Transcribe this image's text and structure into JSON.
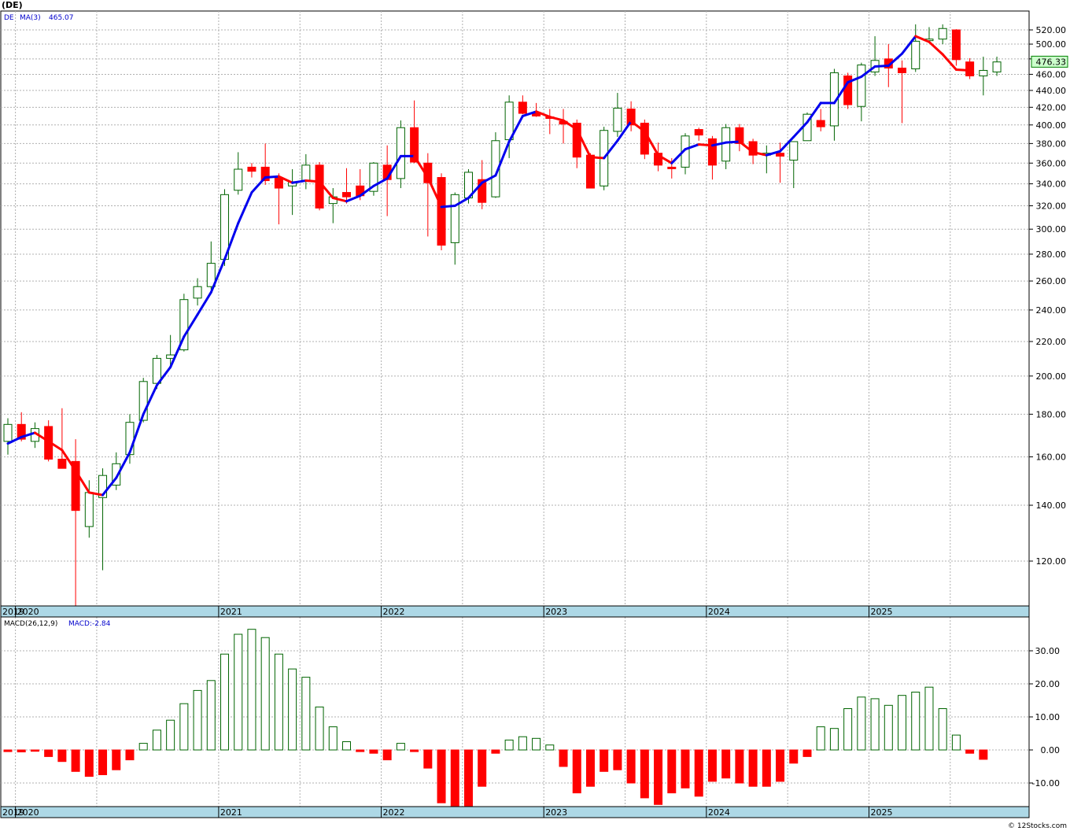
{
  "page": {
    "title": "(DE)",
    "credit": "© 12Stocks.com"
  },
  "colors": {
    "up_candle": "#006400",
    "down_candle": "#ff0000",
    "ma_up": "#0000ee",
    "ma_down": "#ff0000",
    "axis_band": "#add8e6",
    "grid": "#b0b0b0",
    "last_price_box": "#ccffcc"
  },
  "chart_data": [
    {
      "type": "candlestick",
      "ticker": "DE",
      "legend_ticker": "DE",
      "ma_label": "MA(3)",
      "ma_value": "465.07",
      "last_price": "476.33",
      "y_scale": "log",
      "ylim": [
        100,
        540
      ],
      "grid": true,
      "y_ticks": [
        "120.00",
        "140.00",
        "160.00",
        "180.00",
        "200.00",
        "220.00",
        "240.00",
        "260.00",
        "280.00",
        "300.00",
        "320.00",
        "340.00",
        "360.00",
        "380.00",
        "400.00",
        "420.00",
        "440.00",
        "460.00",
        "480.00",
        "500.00",
        "520.00"
      ],
      "x_year_labels": [
        "2019",
        "2020",
        "2021",
        "2022",
        "2023",
        "2024",
        "2025"
      ],
      "x_year_starts": [
        "2019-12",
        "2020-01",
        "2021-01",
        "2022-01",
        "2023-01",
        "2024-01",
        "2025-01"
      ],
      "candles": [
        {
          "d": "2019-12",
          "o": 167,
          "h": 178,
          "l": 161,
          "c": 175
        },
        {
          "d": "2020-01",
          "o": 175,
          "h": 181,
          "l": 167,
          "c": 168
        },
        {
          "d": "2020-01b",
          "o": 167,
          "h": 176,
          "l": 164,
          "c": 173
        },
        {
          "d": "2020-02",
          "o": 174,
          "h": 177,
          "l": 158,
          "c": 159
        },
        {
          "d": "2020-02b",
          "o": 159,
          "h": 183,
          "l": 157,
          "c": 155
        },
        {
          "d": "2020-03",
          "o": 158,
          "h": 168,
          "l": 106,
          "c": 138
        },
        {
          "d": "2020-03b",
          "o": 132,
          "h": 150,
          "l": 128,
          "c": 145
        },
        {
          "d": "2020-04",
          "o": 143,
          "h": 155,
          "l": 117,
          "c": 152
        },
        {
          "d": "2020-05",
          "o": 148,
          "h": 162,
          "l": 146,
          "c": 157
        },
        {
          "d": "2020-06",
          "o": 161,
          "h": 180,
          "l": 157,
          "c": 176
        },
        {
          "d": "2020-07",
          "o": 177,
          "h": 199,
          "l": 176,
          "c": 197
        },
        {
          "d": "2020-08",
          "o": 196,
          "h": 212,
          "l": 193,
          "c": 210
        },
        {
          "d": "2020-09",
          "o": 210,
          "h": 224,
          "l": 204,
          "c": 212
        },
        {
          "d": "2020-10",
          "o": 215,
          "h": 251,
          "l": 214,
          "c": 247
        },
        {
          "d": "2020-11",
          "o": 248,
          "h": 262,
          "l": 243,
          "c": 256
        },
        {
          "d": "2020-12",
          "o": 256,
          "h": 290,
          "l": 254,
          "c": 273
        },
        {
          "d": "2021-01",
          "o": 276,
          "h": 335,
          "l": 271,
          "c": 330
        },
        {
          "d": "2021-02",
          "o": 334,
          "h": 371,
          "l": 330,
          "c": 354
        },
        {
          "d": "2021-03",
          "o": 356,
          "h": 360,
          "l": 346,
          "c": 352
        },
        {
          "d": "2021-04",
          "o": 356,
          "h": 380,
          "l": 339,
          "c": 343
        },
        {
          "d": "2021-05",
          "o": 346,
          "h": 350,
          "l": 304,
          "c": 336
        },
        {
          "d": "2021-06",
          "o": 338,
          "h": 354,
          "l": 312,
          "c": 342
        },
        {
          "d": "2021-07",
          "o": 343,
          "h": 369,
          "l": 335,
          "c": 358
        },
        {
          "d": "2021-08",
          "o": 358,
          "h": 361,
          "l": 316,
          "c": 318
        },
        {
          "d": "2021-09",
          "o": 322,
          "h": 336,
          "l": 305,
          "c": 328
        },
        {
          "d": "2021-10",
          "o": 332,
          "h": 355,
          "l": 322,
          "c": 328
        },
        {
          "d": "2021-11",
          "o": 338,
          "h": 354,
          "l": 325,
          "c": 329
        },
        {
          "d": "2021-12",
          "o": 333,
          "h": 361,
          "l": 329,
          "c": 360
        },
        {
          "d": "2022-01",
          "o": 358,
          "h": 378,
          "l": 311,
          "c": 344
        },
        {
          "d": "2022-02",
          "o": 345,
          "h": 405,
          "l": 336,
          "c": 397
        },
        {
          "d": "2022-03",
          "o": 397,
          "h": 428,
          "l": 360,
          "c": 361
        },
        {
          "d": "2022-04",
          "o": 360,
          "h": 370,
          "l": 294,
          "c": 341
        },
        {
          "d": "2022-05",
          "o": 346,
          "h": 350,
          "l": 283,
          "c": 287
        },
        {
          "d": "2022-06",
          "o": 289,
          "h": 332,
          "l": 272,
          "c": 330
        },
        {
          "d": "2022-07",
          "o": 327,
          "h": 354,
          "l": 322,
          "c": 351
        },
        {
          "d": "2022-08",
          "o": 344,
          "h": 363,
          "l": 317,
          "c": 323
        },
        {
          "d": "2022-09",
          "o": 328,
          "h": 392,
          "l": 327,
          "c": 383
        },
        {
          "d": "2022-10",
          "o": 384,
          "h": 434,
          "l": 365,
          "c": 426
        },
        {
          "d": "2022-11",
          "o": 426,
          "h": 434,
          "l": 412,
          "c": 413
        },
        {
          "d": "2022-12",
          "o": 413,
          "h": 425,
          "l": 409,
          "c": 410
        },
        {
          "d": "2023-01",
          "o": 409,
          "h": 418,
          "l": 390,
          "c": 408
        },
        {
          "d": "2023-02",
          "o": 404,
          "h": 418,
          "l": 380,
          "c": 401
        },
        {
          "d": "2023-03",
          "o": 402,
          "h": 406,
          "l": 355,
          "c": 366
        },
        {
          "d": "2023-04",
          "o": 368,
          "h": 370,
          "l": 336,
          "c": 336
        },
        {
          "d": "2023-05",
          "o": 338,
          "h": 398,
          "l": 334,
          "c": 394
        },
        {
          "d": "2023-06",
          "o": 393,
          "h": 437,
          "l": 387,
          "c": 419
        },
        {
          "d": "2023-07",
          "o": 418,
          "h": 427,
          "l": 393,
          "c": 400
        },
        {
          "d": "2023-08",
          "o": 402,
          "h": 406,
          "l": 364,
          "c": 369
        },
        {
          "d": "2023-09",
          "o": 370,
          "h": 381,
          "l": 352,
          "c": 358
        },
        {
          "d": "2023-10",
          "o": 356,
          "h": 365,
          "l": 345,
          "c": 355
        },
        {
          "d": "2023-11",
          "o": 356,
          "h": 391,
          "l": 349,
          "c": 388
        },
        {
          "d": "2023-12",
          "o": 395,
          "h": 397,
          "l": 383,
          "c": 389
        },
        {
          "d": "2024-01",
          "o": 385,
          "h": 388,
          "l": 344,
          "c": 358
        },
        {
          "d": "2024-02",
          "o": 362,
          "h": 401,
          "l": 354,
          "c": 397
        },
        {
          "d": "2024-03",
          "o": 397,
          "h": 401,
          "l": 372,
          "c": 380
        },
        {
          "d": "2024-04",
          "o": 382,
          "h": 385,
          "l": 359,
          "c": 368
        },
        {
          "d": "2024-05",
          "o": 368,
          "h": 378,
          "l": 350,
          "c": 370
        },
        {
          "d": "2024-06",
          "o": 370,
          "h": 381,
          "l": 341,
          "c": 367
        },
        {
          "d": "2024-07",
          "o": 363,
          "h": 382,
          "l": 336,
          "c": 382
        },
        {
          "d": "2024-08",
          "o": 383,
          "h": 414,
          "l": 383,
          "c": 412
        },
        {
          "d": "2024-09",
          "o": 405,
          "h": 418,
          "l": 393,
          "c": 398
        },
        {
          "d": "2024-10",
          "o": 399,
          "h": 467,
          "l": 383,
          "c": 462
        },
        {
          "d": "2024-11",
          "o": 458,
          "h": 462,
          "l": 418,
          "c": 423
        },
        {
          "d": "2024-12",
          "o": 421,
          "h": 475,
          "l": 404,
          "c": 472
        },
        {
          "d": "2025-01",
          "o": 463,
          "h": 511,
          "l": 458,
          "c": 478
        },
        {
          "d": "2025-02",
          "o": 480,
          "h": 500,
          "l": 444,
          "c": 468
        },
        {
          "d": "2025-03",
          "o": 468,
          "h": 478,
          "l": 402,
          "c": 462
        },
        {
          "d": "2025-04",
          "o": 467,
          "h": 528,
          "l": 463,
          "c": 504
        },
        {
          "d": "2025-05",
          "o": 505,
          "h": 524,
          "l": 504,
          "c": 507
        },
        {
          "d": "2025-06",
          "o": 507,
          "h": 528,
          "l": 500,
          "c": 522
        },
        {
          "d": "2025-07",
          "o": 520,
          "h": 521,
          "l": 471,
          "c": 479
        },
        {
          "d": "2025-08",
          "o": 476,
          "h": 481,
          "l": 454,
          "c": 458
        },
        {
          "d": "2025-09",
          "o": 458,
          "h": 483,
          "l": 434,
          "c": 465
        },
        {
          "d": "2025-10",
          "o": 463,
          "h": 483,
          "l": 458,
          "c": 476
        }
      ],
      "ma": [
        166,
        169,
        171,
        167,
        163,
        154,
        145,
        144,
        151,
        162,
        180,
        195,
        205,
        223,
        237,
        252,
        276,
        305,
        332,
        346,
        347,
        341,
        343,
        342,
        327,
        324,
        329,
        338,
        345,
        367,
        367,
        346,
        319,
        320,
        327,
        341,
        348,
        382,
        410,
        415,
        409,
        405,
        395,
        366,
        365,
        383,
        404,
        393,
        368,
        360,
        374,
        379,
        378,
        381,
        382,
        371,
        368,
        372,
        387,
        403,
        425,
        425,
        450,
        457,
        470,
        471,
        487,
        511,
        503,
        486,
        466,
        465
      ],
      "ma_color_rule": "blue when rising, red when falling"
    },
    {
      "type": "bar",
      "name": "MACD(26,12,9)",
      "value_label": "MACD:-2.84",
      "ylim": [
        -17,
        38
      ],
      "y_ticks": [
        "30.00",
        "20.00",
        "10.00",
        "0.00",
        "-10.00"
      ],
      "grid": true,
      "values": [
        -0.5,
        -0.6,
        -0.4,
        -2,
        -3.5,
        -6.5,
        -8,
        -7.5,
        -6,
        -3,
        2,
        6,
        9,
        14,
        18,
        21,
        29,
        35,
        36.5,
        34,
        29,
        24.5,
        22,
        13,
        7,
        2.5,
        -0.5,
        -1,
        -3,
        2,
        -0.5,
        -5.5,
        -16,
        -17,
        -17,
        -11,
        -1,
        3,
        4,
        3.5,
        1.5,
        -5,
        -13,
        -11,
        -6.5,
        -6,
        -10,
        -14.5,
        -16.5,
        -13,
        -11.5,
        -14,
        -9.5,
        -8.5,
        -10,
        -11,
        -11,
        -9.5,
        -4,
        -2,
        7,
        6.5,
        12.5,
        16,
        15.5,
        13.5,
        16.5,
        17.5,
        19,
        12.5,
        4.5,
        -1,
        -2.84
      ]
    }
  ]
}
